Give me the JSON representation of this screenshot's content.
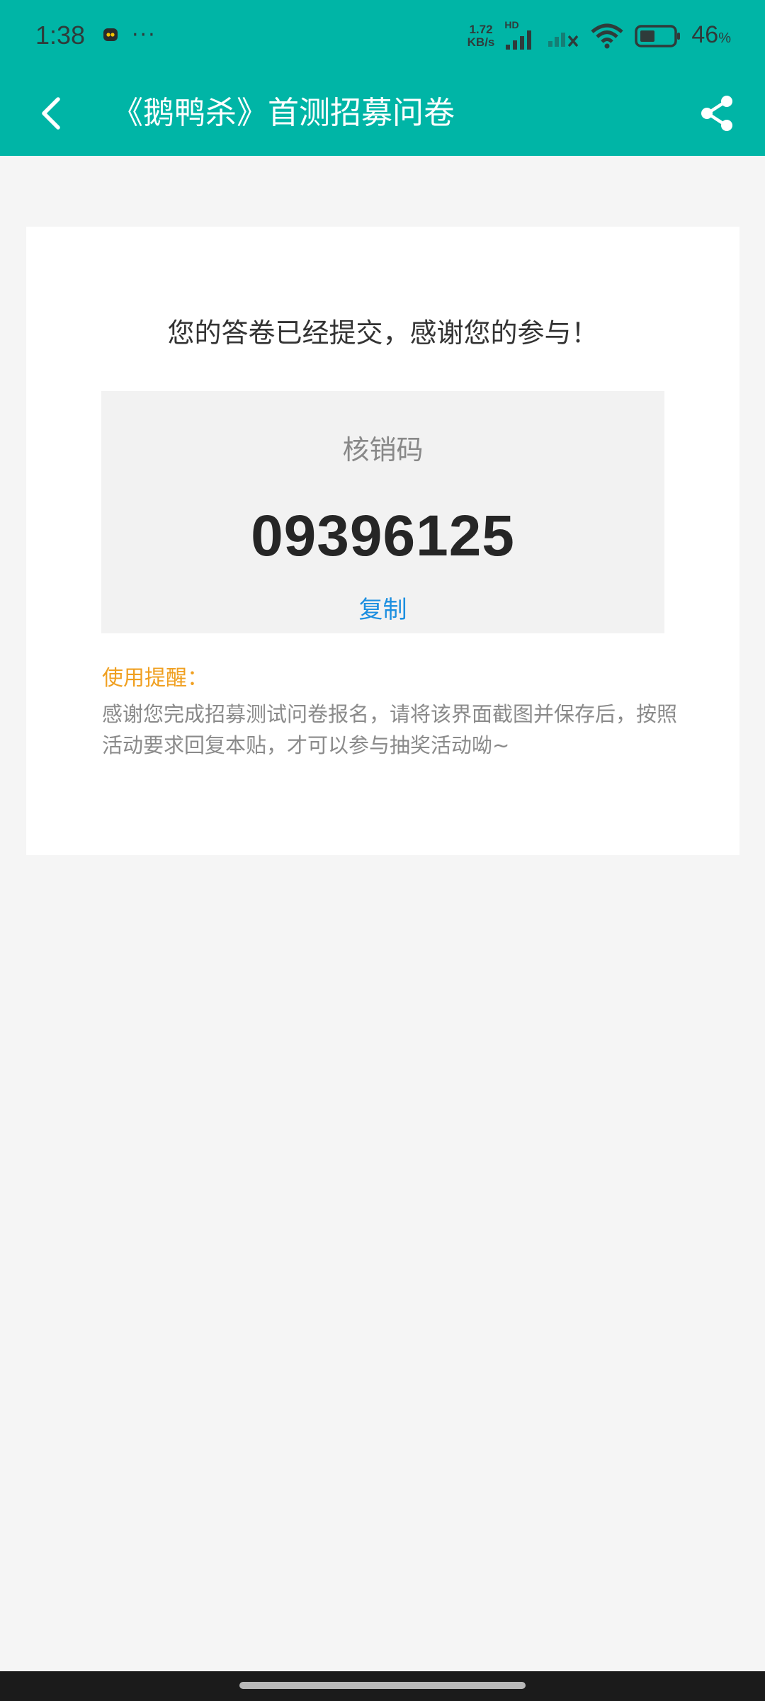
{
  "status_bar": {
    "time": "1:38",
    "more_dots": "···",
    "net_speed_value": "1.72",
    "net_speed_unit": "KB/s",
    "hd_label": "HD",
    "battery_percent": "46",
    "battery_unit": "%",
    "battery_level": 0.46,
    "icons": [
      "app-notification-icon",
      "signal-icon",
      "signal-off-icon",
      "wifi-icon",
      "battery-icon"
    ]
  },
  "toolbar": {
    "title": "《鹅鸭杀》首测招募问卷",
    "back_icon": "back-arrow-icon",
    "share_icon": "share-icon",
    "color": "#00b5a6"
  },
  "result": {
    "message": "您的答卷已经提交，感谢您的参与！",
    "code_label": "核销码",
    "code_value": "09396125",
    "copy_label": "复制",
    "tip_title": "使用提醒：",
    "tip_text": "感谢您完成招募测试问卷报名，请将该界面截图并保存后，按照活动要求回复本贴，才可以参与抽奖活动呦~"
  },
  "colors": {
    "accent": "#00b5a6",
    "link": "#1c8fe0",
    "tip_title": "#f0a021"
  }
}
